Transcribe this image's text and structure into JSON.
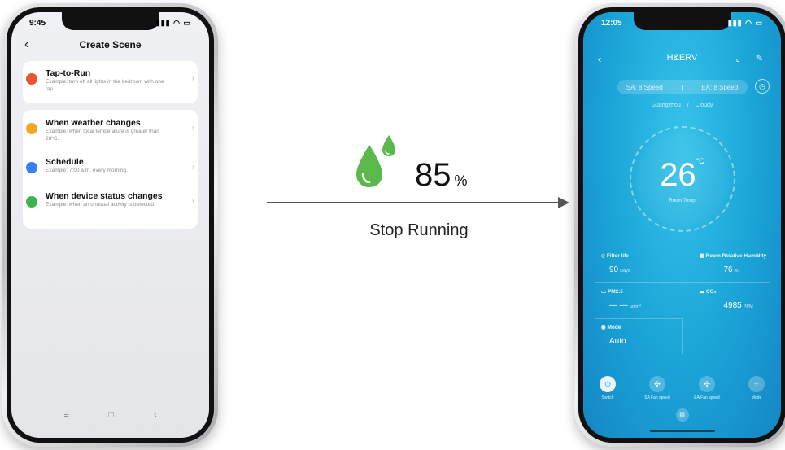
{
  "left_phone": {
    "time": "9:45",
    "title": "Create Scene",
    "options": [
      {
        "title": "Tap-to-Run",
        "desc": "Example: turn off all lights in the bedroom with one tap.",
        "icon": "hand-tap-icon",
        "color": "#e8552f"
      },
      {
        "title": "When weather changes",
        "desc": "Example: when local temperature is greater than 28°C.",
        "icon": "sun-icon",
        "color": "#f5a623"
      },
      {
        "title": "Schedule",
        "desc": "Example: 7:00 a.m. every morning.",
        "icon": "clock-icon",
        "color": "#3b7ff5"
      },
      {
        "title": "When device status changes",
        "desc": "Example: when an unusual activity is detected.",
        "icon": "device-icon",
        "color": "#3fb34f"
      }
    ]
  },
  "middle": {
    "humidity_value": "85",
    "humidity_unit": "%",
    "status": "Stop Running",
    "drop_color": "#5bb84a"
  },
  "right_phone": {
    "time": "12:05",
    "title": "H&ERV",
    "sa_speed": "SA: 8 Speed",
    "ea_speed": "EA: 8 Speed",
    "city": "Guangzhou",
    "weather": "Cloudy",
    "temperature": "26",
    "temp_unit": "°C",
    "temp_label": "Room Temp",
    "metrics": {
      "filter_life_label": "Filter life",
      "filter_life_value": "90",
      "filter_life_unit": "Days",
      "humidity_label": "Room Relative Humidity",
      "humidity_value": "76",
      "humidity_unit": "%",
      "pm25_label": "PM2.5",
      "pm25_value": "— —",
      "pm25_unit": "ug/m³",
      "co2_label": "CO₂",
      "co2_value": "4985",
      "co2_unit": "PPM",
      "mode_label": "Mode",
      "mode_value": "Auto"
    },
    "controls": [
      "Switch",
      "SA Fan speed",
      "EA Fan speed",
      "Mode"
    ]
  }
}
